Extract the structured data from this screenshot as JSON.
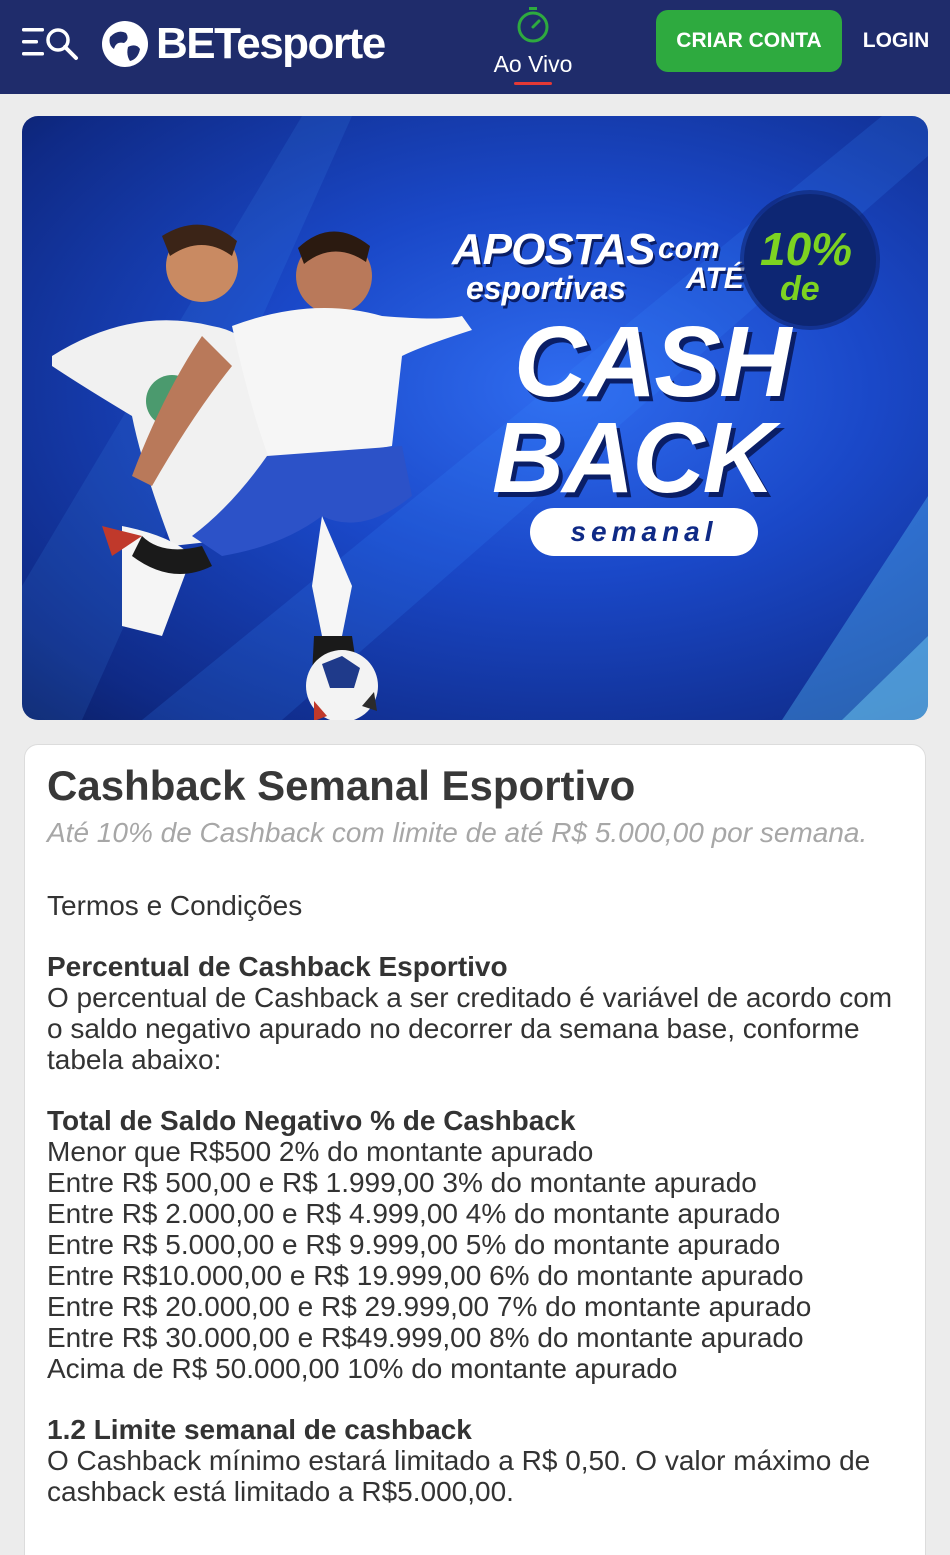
{
  "header": {
    "logo_text": "BETesporte",
    "live_label": "Ao Vivo",
    "signup_label": "CRIAR CONTA",
    "login_label": "LOGIN"
  },
  "banner": {
    "line1": "APOSTAS",
    "line2": "esportivas",
    "com": "com",
    "ate": "ATÉ",
    "pct": "10%",
    "de": "de",
    "cash": "CASH",
    "back": "BACK",
    "semanal": "semanal"
  },
  "promo": {
    "title": "Cashback Semanal Esportivo",
    "subtitle": "Até 10% de Cashback com limite de até R$ 5.000,00 por semana.",
    "terms_title": "Termos e Condições",
    "section1_title": "Percentual de Cashback Esportivo",
    "section1_text": "O percentual de Cashback a ser creditado é variável de acordo com o saldo negativo apurado no decorrer da semana base, conforme tabela abaixo:",
    "table_title": "Total de Saldo Negativo % de Cashback",
    "table_rows": [
      "Menor que R$500 2% do montante apurado",
      "Entre R$ 500,00 e R$ 1.999,00 3% do montante apurado",
      "Entre R$ 2.000,00 e R$ 4.999,00 4% do montante apurado",
      "Entre R$ 5.000,00 e R$ 9.999,00 5% do montante apurado",
      "Entre R$10.000,00 e R$ 19.999,00 6% do montante apurado",
      "Entre R$ 20.000,00 e R$ 29.999,00 7% do montante apurado",
      "Entre R$ 30.000,00 e R$49.999,00 8% do montante apurado",
      "Acima de R$ 50.000,00 10% do montante apurado"
    ],
    "section2_title": "1.2 Limite semanal de cashback",
    "section2_text": "O Cashback mínimo estará limitado a R$ 0,50. O valor máximo de cashback está limitado a R$5.000,00."
  },
  "colors": {
    "header_bg": "#1f2c6b",
    "signup_green": "#2eaa3f",
    "live_green": "#2eaa3f",
    "live_underline": "#e53935",
    "banner_accent": "#7dd321"
  }
}
